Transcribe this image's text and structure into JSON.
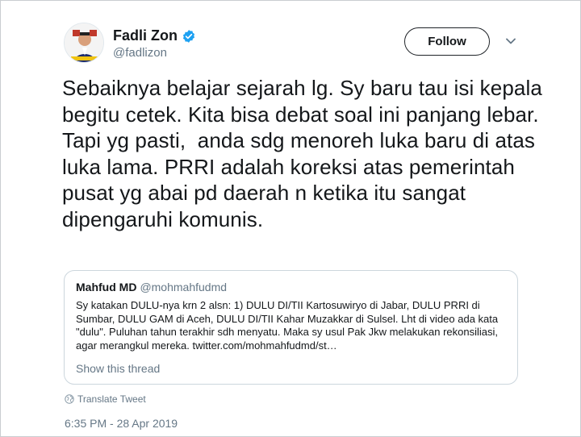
{
  "author": {
    "display_name": "Fadli Zon",
    "handle": "@fadlizon",
    "avatar_icon": "avatar-photo",
    "verified_icon": "verified-badge-icon"
  },
  "actions": {
    "follow_label": "Follow",
    "more_icon": "chevron-down-icon"
  },
  "tweet": {
    "text": "Sebaiknya belajar sejarah lg. Sy baru tau isi kepala begitu cetek. Kita bisa debat soal ini panjang lebar. Tapi yg pasti,  anda sdg menoreh luka baru di atas luka lama. PRRI adalah koreksi atas pemerintah pusat yg abai pd daerah n ketika itu sangat dipengaruhi komunis."
  },
  "quoted_tweet": {
    "display_name": "Mahfud MD",
    "handle": "@mohmahfudmd",
    "text": "Sy katakan DULU-nya krn 2 alsn: 1) DULU DI/TII Kartosuwiryo di Jabar, DULU PRRI di Sumbar, DULU GAM di Aceh, DULU DI/TII Kahar Muzakkar di Sulsel. Lht di video ada kata \"dulu\". Puluhan tahun terakhir sdh menyatu. Maka sy usul Pak Jkw melakukan rekonsiliasi, agar merangkul mereka. twitter.com/mohmahfudmd/st…",
    "show_thread_label": "Show this thread"
  },
  "translate_label": "Translate Tweet",
  "timestamp": "6:35 PM - 28 Apr 2019",
  "colors": {
    "text_primary": "#14171a",
    "text_secondary": "#657786",
    "verified_blue": "#1da1f2",
    "border": "#ccd6dd"
  }
}
